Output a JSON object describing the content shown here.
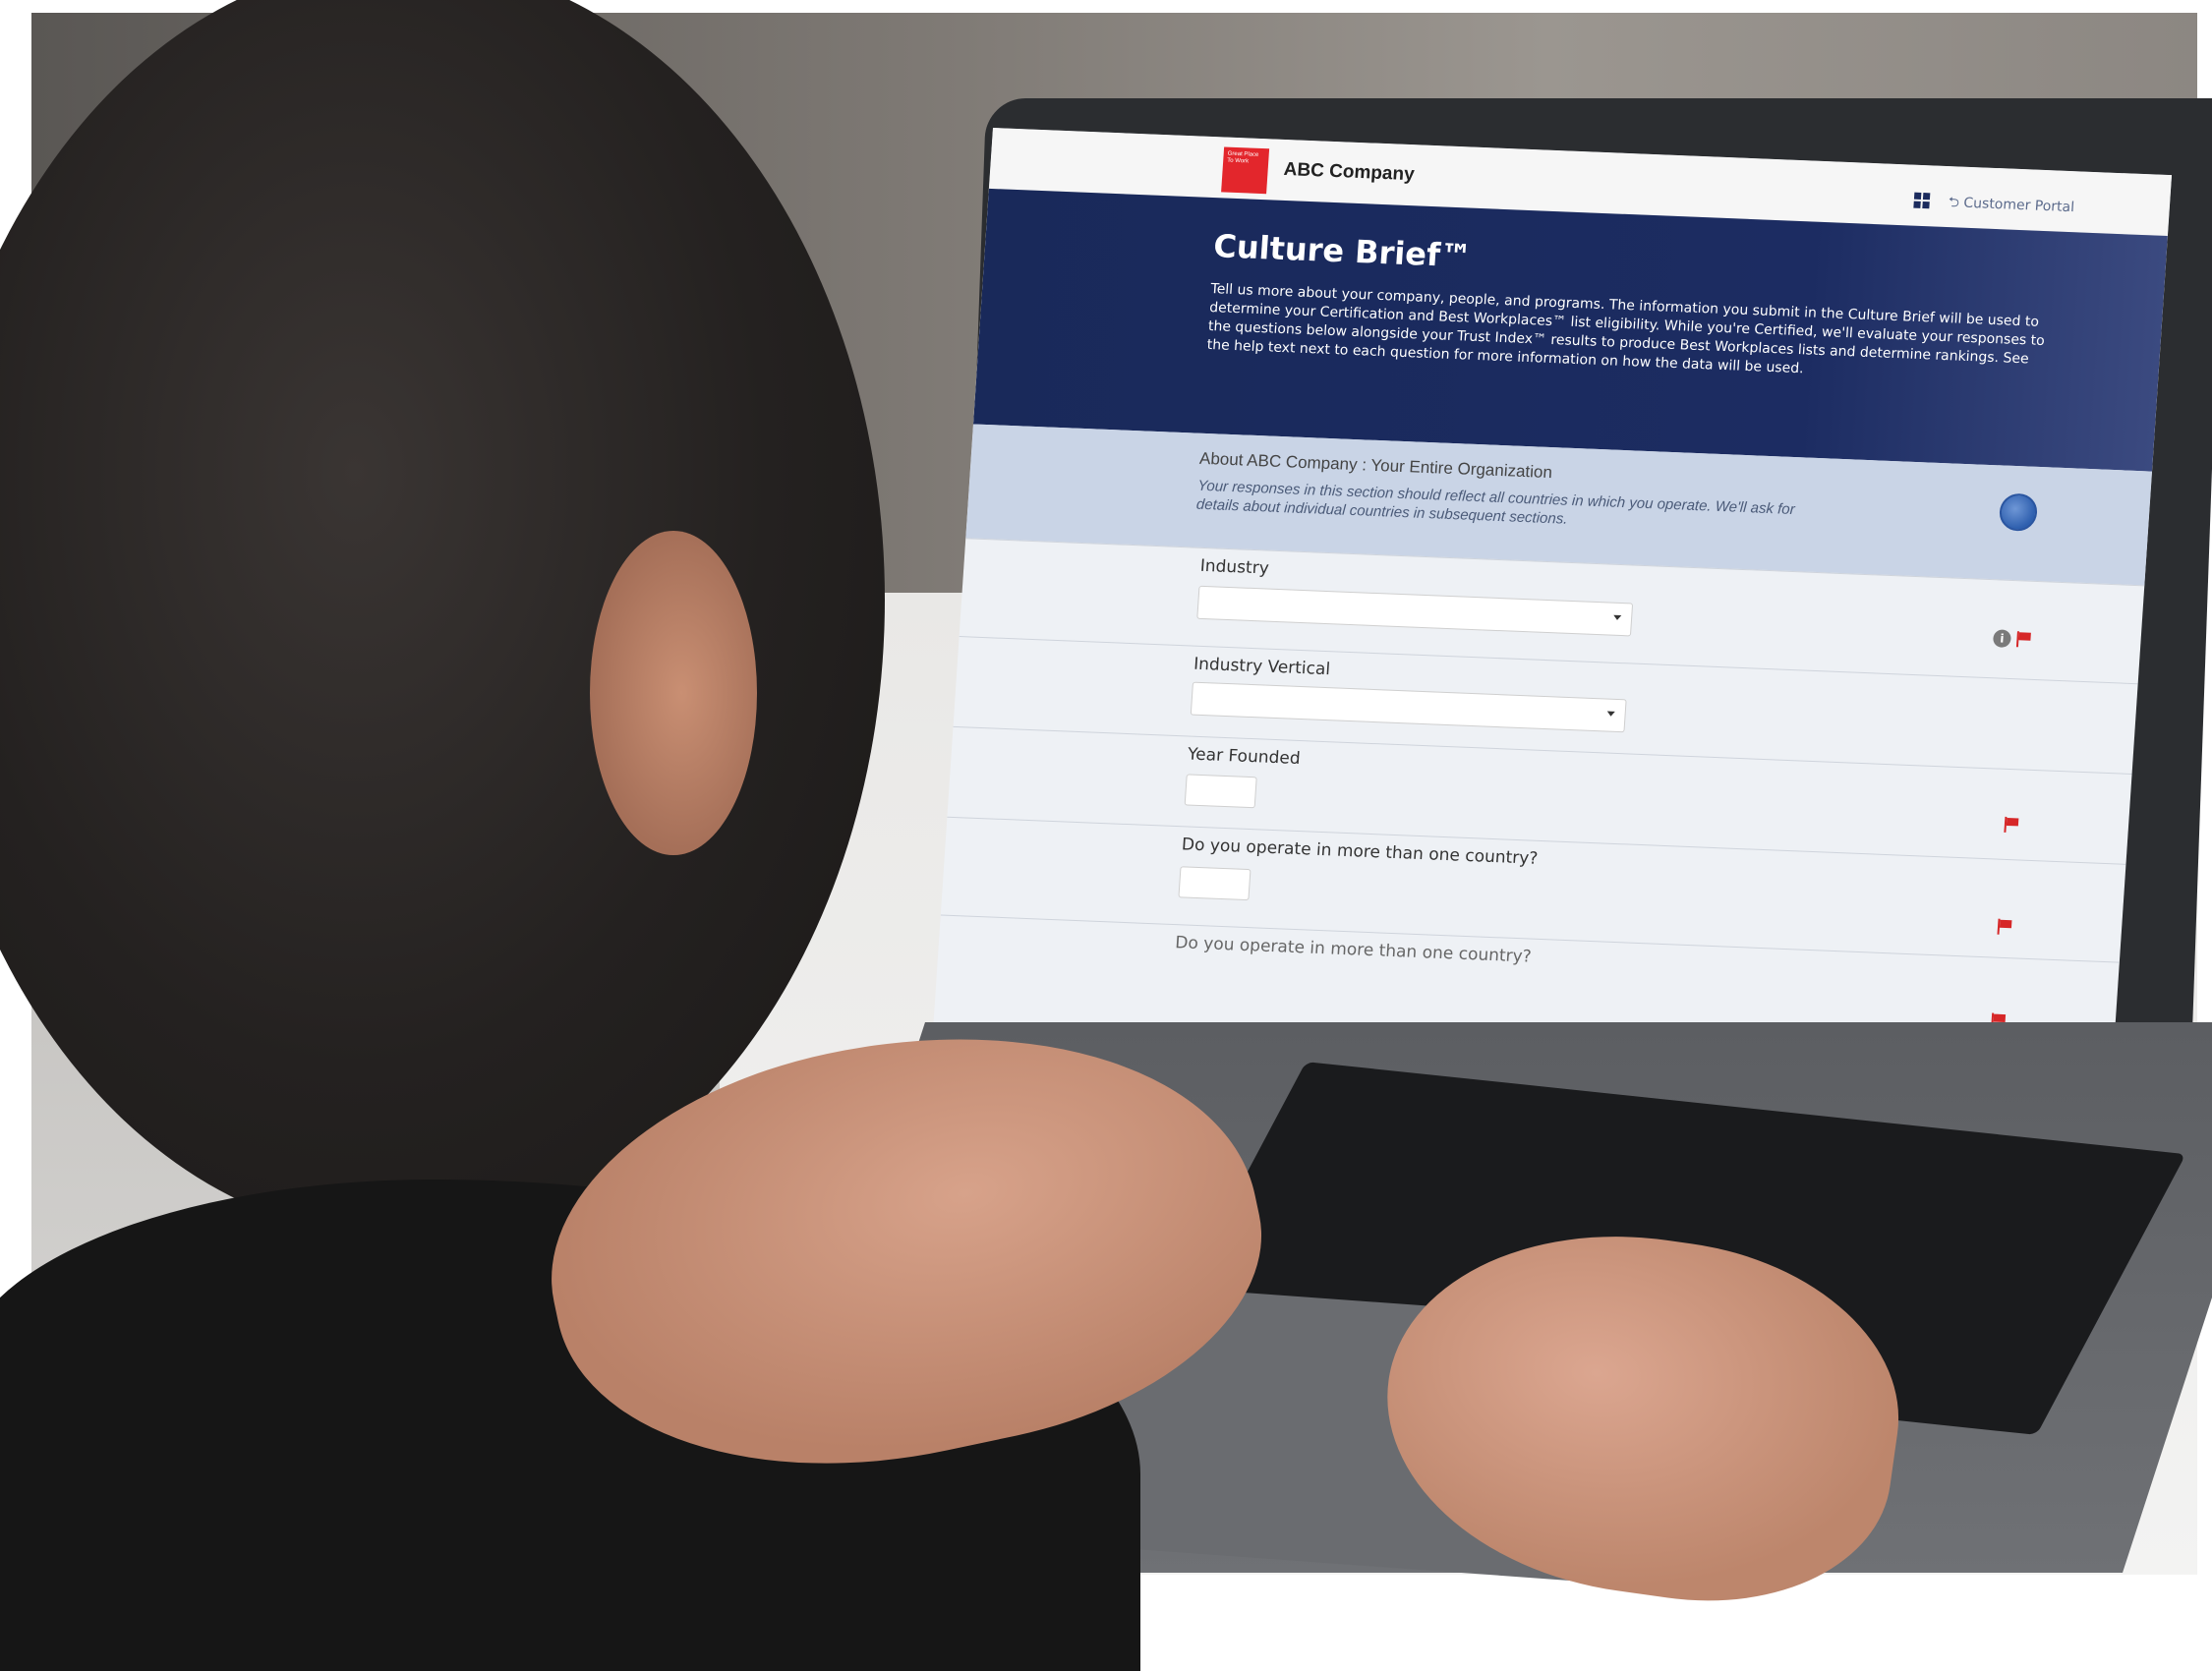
{
  "app": {
    "company_name": "ABC Company",
    "logo_text": "Great Place To Work",
    "nav_link": "Customer Portal",
    "brand_color": "#19295a",
    "accent_color": "#e3262c"
  },
  "hero": {
    "title": "Culture Brief™",
    "description": "Tell us more about your company, people, and programs. The information you submit in the Culture Brief will be used to determine your Certification and Best Workplaces™ list eligibility. While you're Certified, we'll evaluate your responses to the questions below alongside your Trust Index™ results to produce Best Workplaces lists and determine rankings. See the help text next to each question for more information on how the data will be used."
  },
  "section": {
    "title": "About ABC Company : Your Entire Organization",
    "note": "Your responses in this section should reflect all countries in which you operate. We'll ask for details about individual countries in subsequent sections."
  },
  "fields": [
    {
      "label": "Industry",
      "value": ""
    },
    {
      "label": "Industry Vertical",
      "value": ""
    },
    {
      "label": "Year Founded",
      "value": ""
    },
    {
      "label": "Do you operate in more than one country?",
      "value": ""
    },
    {
      "label": "Do you operate in more than one country?",
      "value": ""
    }
  ],
  "icons": {
    "grid": "grid-icon",
    "globe": "globe-icon",
    "info": "info-icon",
    "flag": "flag-icon"
  }
}
